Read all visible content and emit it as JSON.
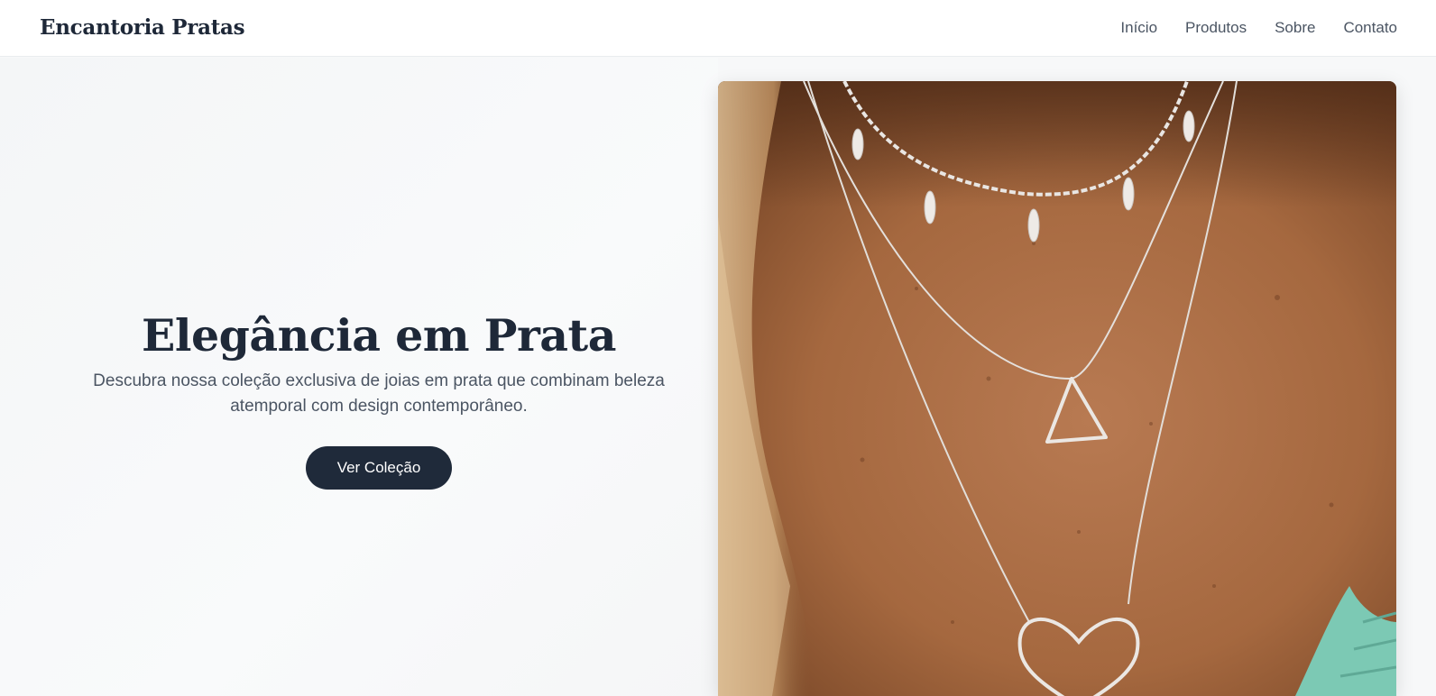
{
  "header": {
    "brand": "Encantoria Pratas",
    "nav": [
      {
        "label": "Início"
      },
      {
        "label": "Produtos"
      },
      {
        "label": "Sobre"
      },
      {
        "label": "Contato"
      }
    ]
  },
  "hero": {
    "title": "Elegância em Prata",
    "subtitle": "Descubra nossa coleção exclusiva de joias em prata que combinam beleza atemporal com design contemporâneo.",
    "cta_label": "Ver Coleção"
  },
  "colors": {
    "primary": "#1f2a3a",
    "text_muted": "#4b5563",
    "background": "#f7f8f9"
  }
}
